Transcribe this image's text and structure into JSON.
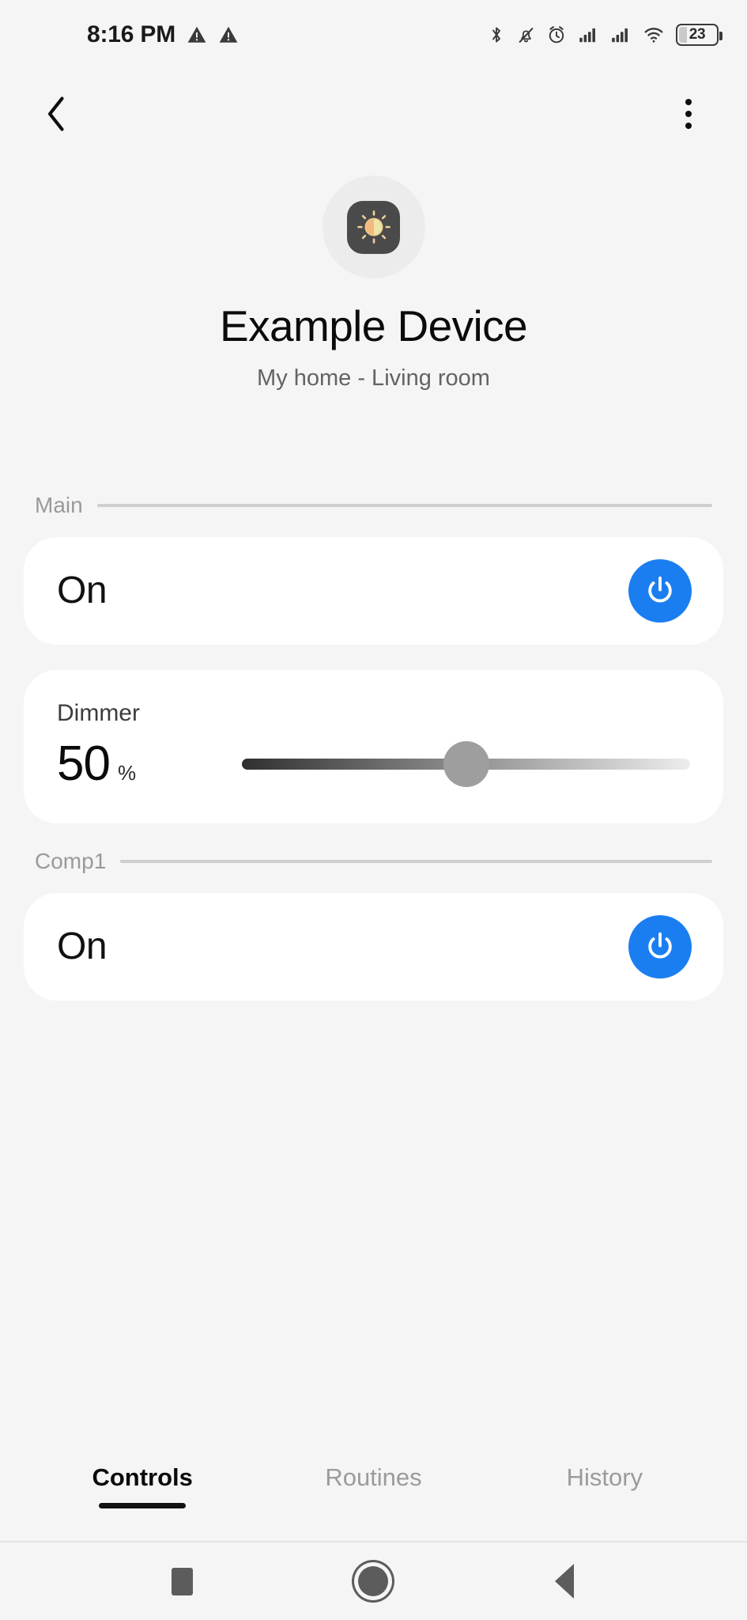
{
  "status_bar": {
    "time": "8:16 PM",
    "battery_level": "23",
    "left_icons": [
      "warning-triangle-icon",
      "warning-triangle-icon"
    ],
    "right_icons": [
      "bluetooth-icon",
      "notifications-silenced-icon",
      "alarm-icon",
      "signal-sim1-icon",
      "signal-sim2-icon",
      "wifi-icon",
      "battery-icon"
    ]
  },
  "app_bar": {
    "back_label": "",
    "menu_label": ""
  },
  "hero": {
    "device_name": "Example Device",
    "location": "My home - Living room",
    "icon": "brightness-sun-icon",
    "icon_bg_color": "#4a4a4a",
    "icon_fg_color": "#f5b97d"
  },
  "sections": [
    {
      "label": "Main",
      "cards": [
        {
          "kind": "toggle",
          "state": "On",
          "power_color": "#1a7ef0"
        },
        {
          "kind": "slider",
          "label": "Dimmer",
          "value": "50",
          "unit": "%",
          "percent": 50
        }
      ]
    },
    {
      "label": "Comp1",
      "cards": [
        {
          "kind": "toggle",
          "state": "On",
          "power_color": "#1a7ef0"
        }
      ]
    }
  ],
  "tabs": [
    {
      "label": "Controls",
      "active": true
    },
    {
      "label": "Routines",
      "active": false
    },
    {
      "label": "History",
      "active": false
    }
  ],
  "nav_bar": {
    "recents": "recents-square-icon",
    "home": "home-circle-icon",
    "back": "back-triangle-icon"
  }
}
